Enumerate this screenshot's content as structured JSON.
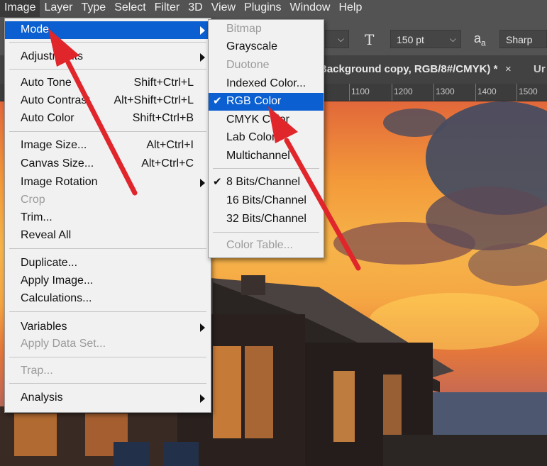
{
  "menubar": {
    "items": [
      "Image",
      "Layer",
      "Type",
      "Select",
      "Filter",
      "3D",
      "View",
      "Plugins",
      "Window",
      "Help"
    ]
  },
  "options": {
    "font_size": "150 pt",
    "aa_label": "a",
    "aa_sub": "a",
    "antialias": "Sharp"
  },
  "tabs": {
    "active_title": "Background copy, RGB/8#/CMYK) *",
    "close": "×",
    "next_title": "Ur"
  },
  "ruler": [
    "1100",
    "1200",
    "1300",
    "1400",
    "1500"
  ],
  "image_menu": {
    "mode": "Mode",
    "adjustments": "Adjustments",
    "auto_tone": "Auto Tone",
    "auto_tone_sc": "Shift+Ctrl+L",
    "auto_contrast": "Auto Contrast",
    "auto_contrast_sc": "Alt+Shift+Ctrl+L",
    "auto_color": "Auto Color",
    "auto_color_sc": "Shift+Ctrl+B",
    "image_size": "Image Size...",
    "image_size_sc": "Alt+Ctrl+I",
    "canvas_size": "Canvas Size...",
    "canvas_size_sc": "Alt+Ctrl+C",
    "image_rotation": "Image Rotation",
    "crop": "Crop",
    "trim": "Trim...",
    "reveal_all": "Reveal All",
    "duplicate": "Duplicate...",
    "apply_image": "Apply Image...",
    "calculations": "Calculations...",
    "variables": "Variables",
    "apply_data_set": "Apply Data Set...",
    "trap": "Trap...",
    "analysis": "Analysis"
  },
  "mode_menu": {
    "bitmap": "Bitmap",
    "grayscale": "Grayscale",
    "duotone": "Duotone",
    "indexed": "Indexed Color...",
    "rgb": "RGB Color",
    "cmyk": "CMYK Color",
    "lab": "Lab Color",
    "multichannel": "Multichannel",
    "bits8": "8 Bits/Channel",
    "bits16": "16 Bits/Channel",
    "bits32": "32 Bits/Channel",
    "color_table": "Color Table...",
    "check": "✔"
  },
  "colors": {
    "highlight": "#0b5fd0",
    "arrow": "#e0262b"
  }
}
